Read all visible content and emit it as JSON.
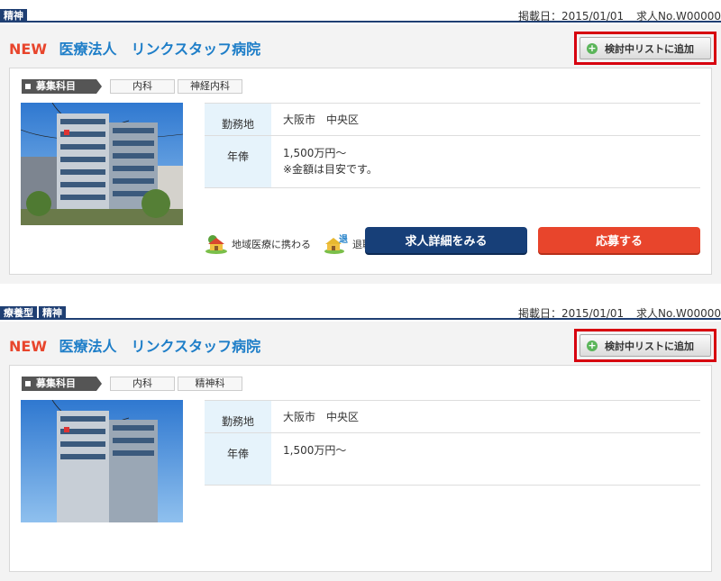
{
  "listings": [
    {
      "badges": [
        "精神"
      ],
      "date_label": "掲載日：2015/01/01",
      "job_no": "求人No.W00000",
      "new_label": "NEW",
      "name": "医療法人　リンクスタッフ病院",
      "add_list_label": "検討中リストに追加",
      "dept_label": "募集科目",
      "departments": [
        "内科",
        "神経内科"
      ],
      "info": [
        {
          "key": "勤務地",
          "value": "大阪市　中央区"
        },
        {
          "key": "年俸",
          "value": "1,500万円～",
          "note": "※金額は目安です。"
        }
      ],
      "features": [
        {
          "icon": "community-house-icon",
          "label": "地域医療に携わる"
        },
        {
          "icon": "retirement-house-icon",
          "label": "退職金制度有り"
        }
      ],
      "detail_button": "求人詳細をみる",
      "apply_button": "応募する"
    },
    {
      "badges": [
        "療養型",
        "精神"
      ],
      "date_label": "掲載日：2015/01/01",
      "job_no": "求人No.W00000",
      "new_label": "NEW",
      "name": "医療法人　リンクスタッフ病院",
      "add_list_label": "検討中リストに追加",
      "dept_label": "募集科目",
      "departments": [
        "内科",
        "精神科"
      ],
      "info": [
        {
          "key": "勤務地",
          "value": "大阪市　中央区"
        },
        {
          "key": "年俸",
          "value": "1,500万円～"
        }
      ]
    }
  ],
  "colors": {
    "navy": "#1f3f73",
    "accent_red": "#e8452c",
    "link_blue": "#1e7ec8",
    "highlight_border": "#d7000f"
  }
}
